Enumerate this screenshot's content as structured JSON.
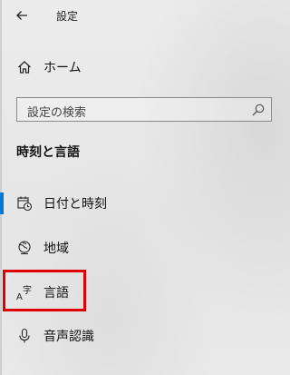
{
  "window": {
    "title": "設定"
  },
  "icons": {
    "back": "back-arrow-icon",
    "home": "home-icon",
    "search": "search-icon",
    "date_time": "calendar-clock-icon",
    "region": "globe-icon",
    "language": "language-icon",
    "speech": "microphone-icon"
  },
  "nav": {
    "home_label": "ホーム"
  },
  "search": {
    "placeholder": "設定の検索"
  },
  "section": {
    "heading": "時刻と言語",
    "items": [
      {
        "label": "日付と時刻",
        "selected": true
      },
      {
        "label": "地域",
        "selected": false
      },
      {
        "label": "言語",
        "selected": false,
        "highlighted": true
      },
      {
        "label": "音声認識",
        "selected": false
      }
    ]
  },
  "colors": {
    "accent": "#0078d7",
    "highlight": "#e00000"
  }
}
